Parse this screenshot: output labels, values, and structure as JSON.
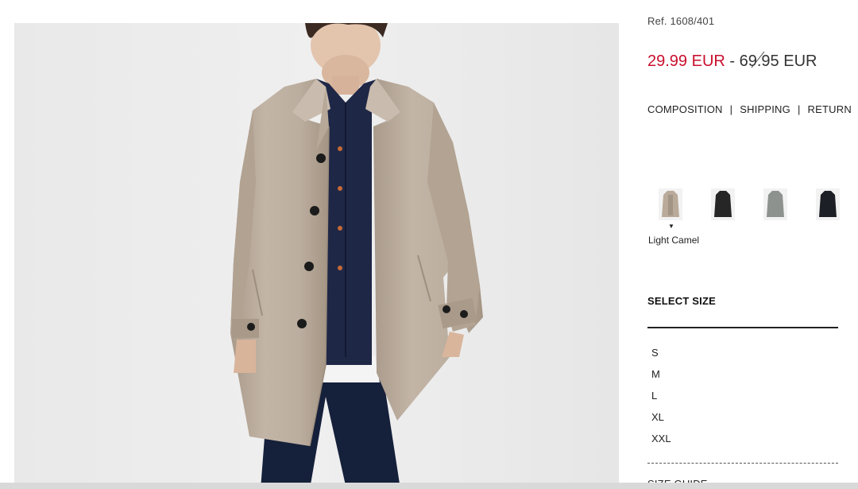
{
  "product": {
    "reference": "Ref. 1608/401",
    "image_alt": "Model wearing light camel coat"
  },
  "price": {
    "sale": "29.99 EUR",
    "separator": " - ",
    "original": "69.95 EUR"
  },
  "info_links": [
    {
      "label": "COMPOSITION"
    },
    {
      "label": "SHIPPING"
    },
    {
      "label": "RETURN"
    }
  ],
  "link_separator": "|",
  "colors": {
    "selected_name": "Light Camel",
    "selected_marker": "▼",
    "swatches": [
      {
        "name": "light-camel",
        "hex": "#b9aa9a"
      },
      {
        "name": "black",
        "hex": "#262626"
      },
      {
        "name": "grey",
        "hex": "#8e928f"
      },
      {
        "name": "navy-black",
        "hex": "#1c1f26"
      }
    ]
  },
  "sizes": {
    "title": "SELECT SIZE",
    "options": [
      "S",
      "M",
      "L",
      "XL",
      "XXL"
    ],
    "guide_label": "SIZE GUIDE"
  },
  "theme": {
    "sale_color": "#c8102e",
    "image_background": "#ececec",
    "coat_color": "#bcae9f"
  }
}
